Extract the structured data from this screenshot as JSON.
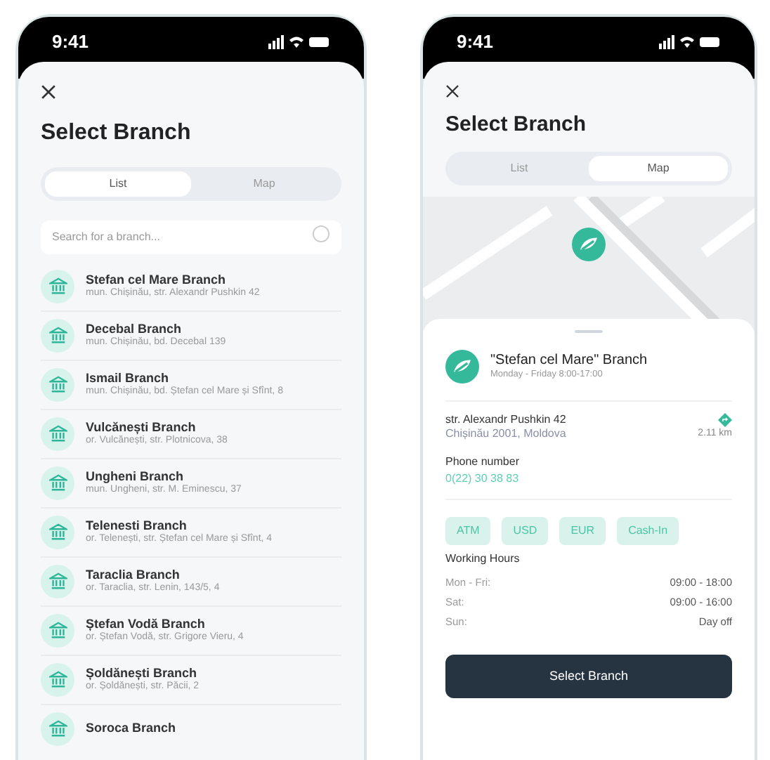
{
  "screens": [
    {
      "status": {
        "time": "9:41"
      },
      "title": "Select Branch",
      "tabs": [
        {
          "label": "List",
          "selected": true
        },
        {
          "label": "Map",
          "selected": false
        }
      ],
      "search": {
        "placeholder": "Search for a branch..."
      },
      "branches": [
        {
          "name": "Stefan cel Mare Branch",
          "address": "mun. Chișinău, str. Alexandr Pushkin 42"
        },
        {
          "name": "Decebal Branch",
          "address": "mun. Chișinău, bd. Decebal 139"
        },
        {
          "name": "Ismail Branch",
          "address": "mun. Chișinău, bd. Ștefan cel Mare și Sfînt, 8"
        },
        {
          "name": "Vulcănești Branch",
          "address": "or. Vulcănești, str. Plotnicova, 38"
        },
        {
          "name": "Ungheni Branch",
          "address": "mun. Ungheni, str. M. Eminescu, 37"
        },
        {
          "name": "Telenesti Branch",
          "address": "or. Telenești, str. Ștefan cel Mare și Sfînt, 4"
        },
        {
          "name": "Taraclia Branch",
          "address": "or. Taraclia, str. Lenin, 143/5, 4"
        },
        {
          "name": "Ștefan Vodă Branch",
          "address": "or. Ștefan Vodă, str. Grigore Vieru, 4"
        },
        {
          "name": "Șoldănești Branch",
          "address": "or. Șoldănești, str. Păcii, 2"
        },
        {
          "name": "Soroca Branch"
        }
      ]
    },
    {
      "status": {
        "time": "9:41"
      },
      "title": "Select Branch",
      "tabs": [
        {
          "label": "List",
          "selected": false
        },
        {
          "label": "Map",
          "selected": true
        }
      ],
      "detail": {
        "name": "\"Stefan cel Mare\" Branch",
        "schedule": "Monday - Friday 8:00-17:00",
        "street": "str. Alexandr Pushkin 42",
        "city": "Chișinău 2001, Moldova",
        "distance": "2.11 km",
        "phone_label": "Phone number",
        "phone": "0(22) 30 38 83",
        "services": [
          "ATM",
          "USD",
          "EUR",
          "Cash-In"
        ],
        "hours_title": "Working Hours",
        "hours": [
          {
            "day": "Mon - Fri:",
            "time": "09:00 - 18:00"
          },
          {
            "day": "Sat:",
            "time": "09:00 - 16:00"
          },
          {
            "day": "Sun:",
            "time": "Day off"
          }
        ],
        "button": "Select Branch"
      }
    }
  ]
}
